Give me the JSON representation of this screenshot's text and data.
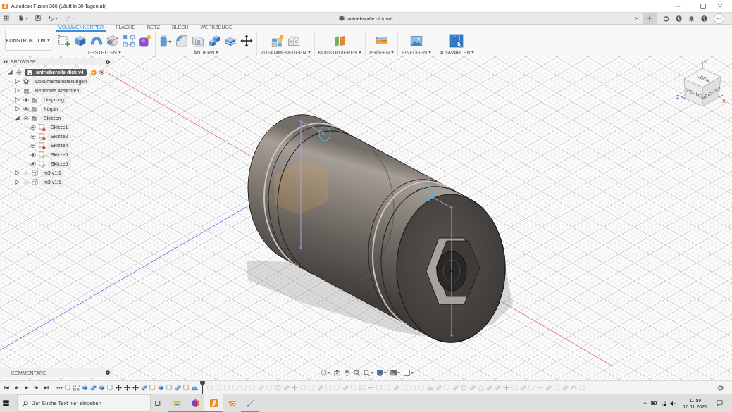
{
  "window": {
    "title": "Autodesk Fusion 360 (Läuft in 30 Tagen ab)"
  },
  "quick_access": [
    {
      "kind": "file",
      "disabled": false
    },
    {
      "kind": "save",
      "disabled": false
    },
    {
      "kind": "undo",
      "disabled": false
    },
    {
      "kind": "redo",
      "disabled": true
    }
  ],
  "document_tab": {
    "title": "antriebsrolle dick v4*"
  },
  "user": {
    "initials": "HJ"
  },
  "workspace": {
    "label": "KONSTRUKTION"
  },
  "ribbon_tabs": [
    {
      "label": "VOLUMENKÖRPER",
      "selected": true
    },
    {
      "label": "FLÄCHE",
      "selected": false
    },
    {
      "label": "NETZ",
      "selected": false
    },
    {
      "label": "BLECH",
      "selected": false
    },
    {
      "label": "WERKZEUGE",
      "selected": false
    }
  ],
  "ribbon_groups": [
    {
      "label": "ERSTELLEN"
    },
    {
      "label": "ÄNDERN"
    },
    {
      "label": "ZUSAMMENFÜGEN"
    },
    {
      "label": "KONSTRUIEREN"
    },
    {
      "label": "PRÜFEN"
    },
    {
      "label": "EINFÜGEN"
    },
    {
      "label": "AUSWÄHLEN"
    }
  ],
  "browser": {
    "title": "BROWSER",
    "root": {
      "label": "antriebsrolle dick v4",
      "active": true,
      "expanded": true,
      "visible": true,
      "children": [
        {
          "label": "Dokumenteinstellungen",
          "kind": "settings",
          "expanded": false
        },
        {
          "label": "Benannte Ansichten",
          "kind": "folder",
          "expanded": false
        },
        {
          "label": "Ursprung",
          "kind": "folder",
          "expanded": false,
          "visible": true
        },
        {
          "label": "Körper",
          "kind": "folder",
          "expanded": false,
          "visible": true
        },
        {
          "label": "Skizzen",
          "kind": "folder",
          "expanded": true,
          "visible": true,
          "children": [
            {
              "label": "Skizze1",
              "kind": "sketch",
              "visible": true,
              "locked": true
            },
            {
              "label": "Skizze2",
              "kind": "sketch",
              "visible": true,
              "locked": true
            },
            {
              "label": "Skizze4",
              "kind": "sketch",
              "visible": true,
              "locked": true
            },
            {
              "label": "Skizze5",
              "kind": "sketch",
              "visible": true,
              "locked": false
            },
            {
              "label": "Skizze6",
              "kind": "sketch",
              "visible": true,
              "locked": false
            }
          ]
        },
        {
          "label": "m3 v1:1",
          "kind": "component",
          "expanded": false,
          "visible": false
        },
        {
          "label": "m3 v1:1",
          "kind": "component",
          "expanded": false,
          "visible": false
        }
      ]
    }
  },
  "view_cube": {
    "faces": [
      "OBEN",
      "VORNE",
      "RECHTS"
    ],
    "axes": [
      "Y",
      "Z",
      "X"
    ]
  },
  "comments_panel": {
    "title": "KOMMENTARE"
  },
  "timeline": {
    "features": [
      {
        "kind": "dots",
        "rolled_back": false
      },
      {
        "kind": "sketch",
        "rolled_back": false
      },
      {
        "kind": "array",
        "rolled_back": false
      },
      {
        "kind": "extrude",
        "rolled_back": false
      },
      {
        "kind": "combine",
        "rolled_back": false
      },
      {
        "kind": "extrude",
        "rolled_back": false
      },
      {
        "kind": "sketch",
        "rolled_back": false
      },
      {
        "kind": "move",
        "rolled_back": false
      },
      {
        "kind": "move",
        "rolled_back": false
      },
      {
        "kind": "move",
        "rolled_back": false
      },
      {
        "kind": "combine",
        "rolled_back": false
      },
      {
        "kind": "sketch",
        "rolled_back": false
      },
      {
        "kind": "extrude",
        "rolled_back": false
      },
      {
        "kind": "sketch",
        "rolled_back": false
      },
      {
        "kind": "combine",
        "rolled_back": false
      },
      {
        "kind": "sketch",
        "rolled_back": false
      },
      {
        "kind": "form",
        "rolled_back": false
      },
      {
        "kind": "sketch",
        "rolled_back": true
      },
      {
        "kind": "sketch",
        "rolled_back": true
      },
      {
        "kind": "sketch",
        "rolled_back": true
      },
      {
        "kind": "sketch",
        "rolled_back": true
      },
      {
        "kind": "sketch",
        "rolled_back": true
      },
      {
        "kind": "sketch",
        "rolled_back": true
      },
      {
        "kind": "combine",
        "rolled_back": true
      },
      {
        "kind": "sketch",
        "rolled_back": true
      },
      {
        "kind": "hole",
        "rolled_back": true
      },
      {
        "kind": "combine",
        "rolled_back": true
      },
      {
        "kind": "move",
        "rolled_back": true
      },
      {
        "kind": "sketch",
        "rolled_back": true
      },
      {
        "kind": "sketch",
        "rolled_back": true
      },
      {
        "kind": "combine",
        "rolled_back": true
      },
      {
        "kind": "sketch",
        "rolled_back": true
      },
      {
        "kind": "sketch",
        "rolled_back": true
      },
      {
        "kind": "combine",
        "rolled_back": true
      },
      {
        "kind": "sketch",
        "rolled_back": true
      },
      {
        "kind": "array",
        "rolled_back": true
      },
      {
        "kind": "move",
        "rolled_back": true
      },
      {
        "kind": "sketch",
        "rolled_back": true
      },
      {
        "kind": "sketch",
        "rolled_back": true
      },
      {
        "kind": "combine",
        "rolled_back": true
      },
      {
        "kind": "sketch",
        "rolled_back": true
      },
      {
        "kind": "sketch",
        "rolled_back": true
      },
      {
        "kind": "sketch",
        "rolled_back": true
      },
      {
        "kind": "form",
        "rolled_back": true
      },
      {
        "kind": "combine",
        "rolled_back": true
      },
      {
        "kind": "sketch",
        "rolled_back": true
      },
      {
        "kind": "combine",
        "rolled_back": true
      },
      {
        "kind": "hole",
        "rolled_back": true
      },
      {
        "kind": "combine",
        "rolled_back": true
      },
      {
        "kind": "plane",
        "rolled_back": true
      },
      {
        "kind": "combine",
        "rolled_back": true
      },
      {
        "kind": "combine",
        "rolled_back": true
      },
      {
        "kind": "move",
        "rolled_back": true
      },
      {
        "kind": "sketch",
        "rolled_back": true
      },
      {
        "kind": "combine",
        "rolled_back": true
      },
      {
        "kind": "sketch",
        "rolled_back": true
      },
      {
        "kind": "dots",
        "rolled_back": true
      },
      {
        "kind": "combine",
        "rolled_back": true
      },
      {
        "kind": "sketch",
        "rolled_back": true
      },
      {
        "kind": "combine",
        "rolled_back": true
      },
      {
        "kind": "revolve",
        "rolled_back": true
      },
      {
        "kind": "sketch",
        "rolled_back": true
      }
    ]
  },
  "taskbar": {
    "search": {
      "placeholder": "Zur Suche Text hier eingeben"
    },
    "apps": [
      {
        "kind": "folder",
        "running": true,
        "selected": false
      },
      {
        "kind": "browser",
        "running": true,
        "selected": false
      },
      {
        "kind": "cad",
        "running": true,
        "selected": true
      },
      {
        "kind": "render",
        "running": false,
        "selected": false
      },
      {
        "kind": "paint",
        "running": true,
        "selected": false
      }
    ],
    "time": "11:59",
    "date": "10.11.2021"
  }
}
